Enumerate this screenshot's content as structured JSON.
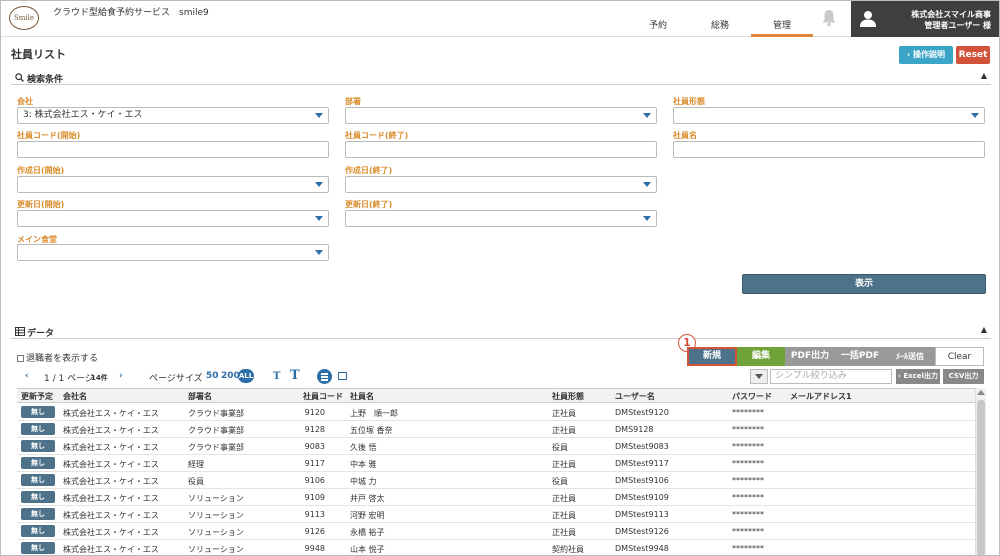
{
  "header": {
    "logo_text": "Smile",
    "app_title": "クラウド型給食予約サービス　smile9",
    "nav": [
      {
        "label": "予約",
        "active": false
      },
      {
        "label": "総務",
        "active": false
      },
      {
        "label": "管理",
        "active": true
      }
    ],
    "company": "株式会社スマイル商事",
    "user": "管理者ユーザー 様"
  },
  "page": {
    "title": "社員リスト",
    "help_button": "‹ 操作説明",
    "reset_button": "Reset"
  },
  "search": {
    "section_title": "検索条件",
    "fields": {
      "company": {
        "label": "会社",
        "value": "3: 株式会社エス・ケイ・エス"
      },
      "department": {
        "label": "部署",
        "value": ""
      },
      "employment_type": {
        "label": "社員形態",
        "value": ""
      },
      "code_start": {
        "label": "社員コード(開始)",
        "value": ""
      },
      "code_end": {
        "label": "社員コード(終了)",
        "value": ""
      },
      "name": {
        "label": "社員名",
        "value": ""
      },
      "created_start": {
        "label": "作成日(開始)",
        "value": ""
      },
      "created_end": {
        "label": "作成日(終了)",
        "value": ""
      },
      "updated_start": {
        "label": "更新日(開始)",
        "value": ""
      },
      "updated_end": {
        "label": "更新日(終了)",
        "value": ""
      },
      "main_cafeteria": {
        "label": "メイン食堂",
        "value": ""
      }
    },
    "show_button": "表示"
  },
  "data": {
    "section_title": "データ",
    "show_retired": "退職者を表示する",
    "callout": "1",
    "buttons": {
      "new": "新規",
      "edit": "編集",
      "pdf": "PDF出力",
      "bulk_pdf": "一括PDF",
      "mail": "ﾒｰﾙ送信",
      "clear": "Clear",
      "excel": "‹ Excel出力",
      "csv": "CSV出力"
    },
    "pager": {
      "page_text": "1 / 1 ページ",
      "count": "14件",
      "page_size_label": "ページサイズ",
      "size_50": "50",
      "size_200": "200",
      "size_all": "ALL",
      "font_small": "T",
      "font_large": "T"
    },
    "filter_placeholder": "シンプル絞り込み",
    "columns": [
      "更新予定",
      "会社名",
      "部署名",
      "社員コード",
      "社員名",
      "社員形態",
      "ユーザー名",
      "パスワード",
      "メールアドレス1"
    ],
    "rows": [
      {
        "schedule": "無し",
        "company": "株式会社エス・ケイ・エス",
        "dept": "クラウド事業部",
        "code": "9120",
        "name": "上野　順一郎",
        "type": "正社員",
        "user": "DMStest9120",
        "password": "********",
        "email": ""
      },
      {
        "schedule": "無し",
        "company": "株式会社エス・ケイ・エス",
        "dept": "クラウド事業部",
        "code": "9128",
        "name": "五位塚 香奈",
        "type": "正社員",
        "user": "DMS9128",
        "password": "********",
        "email": ""
      },
      {
        "schedule": "無し",
        "company": "株式会社エス・ケイ・エス",
        "dept": "クラウド事業部",
        "code": "9083",
        "name": "久後 悟",
        "type": "役員",
        "user": "DMStest9083",
        "password": "********",
        "email": ""
      },
      {
        "schedule": "無し",
        "company": "株式会社エス・ケイ・エス",
        "dept": "経理",
        "code": "9117",
        "name": "中本 雅",
        "type": "正社員",
        "user": "DMStest9117",
        "password": "********",
        "email": ""
      },
      {
        "schedule": "無し",
        "company": "株式会社エス・ケイ・エス",
        "dept": "役員",
        "code": "9106",
        "name": "中城 力",
        "type": "役員",
        "user": "DMStest9106",
        "password": "********",
        "email": ""
      },
      {
        "schedule": "無し",
        "company": "株式会社エス・ケイ・エス",
        "dept": "ソリューション",
        "code": "9109",
        "name": "井戸 啓太",
        "type": "正社員",
        "user": "DMStest9109",
        "password": "********",
        "email": ""
      },
      {
        "schedule": "無し",
        "company": "株式会社エス・ケイ・エス",
        "dept": "ソリューション",
        "code": "9113",
        "name": "河野 宏明",
        "type": "正社員",
        "user": "DMStest9113",
        "password": "********",
        "email": ""
      },
      {
        "schedule": "無し",
        "company": "株式会社エス・ケイ・エス",
        "dept": "ソリューション",
        "code": "9126",
        "name": "永橋 裕子",
        "type": "正社員",
        "user": "DMStest9126",
        "password": "********",
        "email": ""
      },
      {
        "schedule": "無し",
        "company": "株式会社エス・ケイ・エス",
        "dept": "ソリューション",
        "code": "9948",
        "name": "山本 悦子",
        "type": "契約社員",
        "user": "DMStest9948",
        "password": "********",
        "email": ""
      }
    ]
  }
}
